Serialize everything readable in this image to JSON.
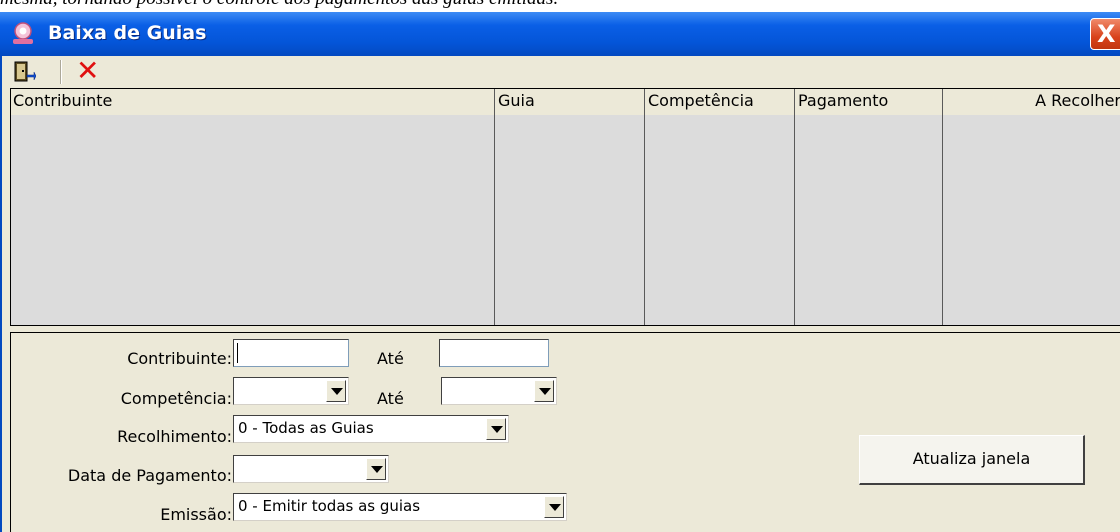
{
  "doc_text": "mesma, tornando possível o controle dos pagamentos das guias emitidas.",
  "window": {
    "title": "Baixa de Guias",
    "close_label": "X"
  },
  "toolbar": {
    "exit_icon": "exit-door-icon",
    "delete_icon": "delete-x-icon",
    "delete_glyph": "✕"
  },
  "grid": {
    "columns": [
      "Contribuinte",
      "Guia",
      "Competência",
      "Pagamento",
      "A Recolher"
    ]
  },
  "form": {
    "contribuinte_label": "Contribuinte:",
    "contribuinte_ate_label": "Até",
    "competencia_label": "Competência:",
    "competencia_ate_label": "Até",
    "recolhimento_label": "Recolhimento:",
    "recolhimento_value": "0 - Todas as Guias",
    "data_pagamento_label": "Data de Pagamento:",
    "emissao_label": "Emissão:",
    "emissao_value": "0 - Emitir todas as guias",
    "atualiza_button": "Atualiza janela"
  },
  "colors": {
    "titlebar": "#0455d8",
    "window_bg": "#ece9d8",
    "grid_bg": "#dcdcdc",
    "close": "#d9431c"
  }
}
